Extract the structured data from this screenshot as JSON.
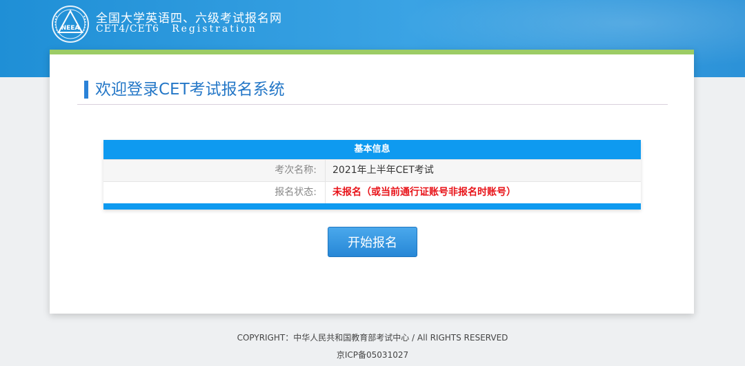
{
  "header": {
    "title": "全国大学英语四、六级考试报名网",
    "subtitle": "CET4/CET6",
    "subtitle_en": "Registration",
    "logo_text": "NEEA"
  },
  "main": {
    "welcome_title": "欢迎登录CET考试报名系统",
    "panel": {
      "heading": "基本信息",
      "rows": [
        {
          "label": "考次名称:",
          "value": "2021年上半年CET考试"
        },
        {
          "label": "报名状态:",
          "value": "未报名（或当前通行证账号非报名时账号）"
        }
      ]
    },
    "start_button_label": "开始报名"
  },
  "footer": {
    "copyright": "COPYRIGHT：中华人民共和国教育部考试中心 / All RIGHTS RESERVED",
    "icp": "京ICP备05031027"
  },
  "colors": {
    "header_blue": "#1f8fd6",
    "panel_blue": "#0e9af0",
    "accent_green": "#9ccc65",
    "status_red": "#e8141a",
    "title_blue": "#2477c7"
  },
  "icons": [
    "neea-logo-icon"
  ]
}
